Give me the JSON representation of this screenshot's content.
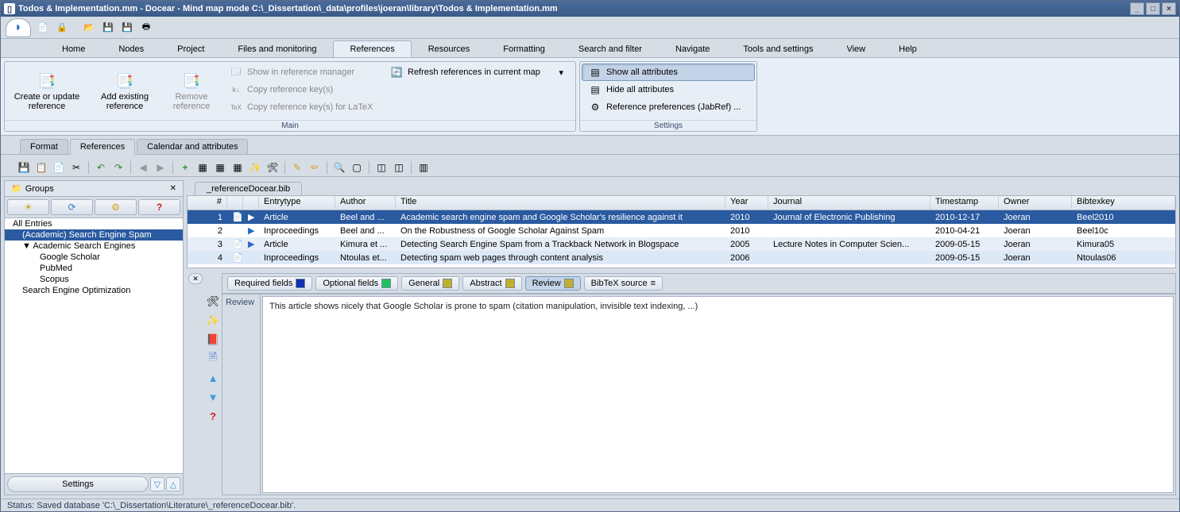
{
  "title": "Todos & Implementation.mm - Docear - Mind map mode C:\\_Dissertation\\_data\\profiles\\joeran\\library\\Todos & Implementation.mm",
  "menus": [
    "Home",
    "Nodes",
    "Project",
    "Files and monitoring",
    "References",
    "Resources",
    "Formatting",
    "Search and filter",
    "Navigate",
    "Tools and settings",
    "View",
    "Help"
  ],
  "active_menu": 4,
  "ribbon": {
    "main_label": "Main",
    "settings_label": "Settings",
    "create": "Create or update reference",
    "add": "Add existing reference",
    "remove": "Remove reference",
    "show_mgr": "Show in reference manager",
    "copy_key": "Copy reference key(s)",
    "copy_latex": "Copy reference key(s) for LaTeX",
    "refresh": "Refresh references in current map",
    "show_attr": "Show all attributes",
    "hide_attr": "Hide all attributes",
    "ref_prefs": "Reference preferences (JabRef) ..."
  },
  "subtabs": [
    "Format",
    "References",
    "Calendar and attributes"
  ],
  "active_subtab": 1,
  "groups_title": "Groups",
  "settings_btn": "Settings",
  "tree": {
    "all": "All Entries",
    "spam": "(Academic) Search Engine Spam",
    "engines": "Academic Search Engines",
    "google": "Google Scholar",
    "pubmed": "PubMed",
    "scopus": "Scopus",
    "seo": "Search Engine Optimization"
  },
  "file_tab": "_referenceDocear.bib",
  "columns": [
    "#",
    "",
    "",
    "Entrytype",
    "Author",
    "Title",
    "Year",
    "Journal",
    "Timestamp",
    "Owner",
    "Bibtexkey"
  ],
  "rows": [
    {
      "n": "1",
      "pdf": "📄",
      "u": "▶",
      "type": "Article",
      "auth": "Beel and ...",
      "title": "Academic search engine spam and Google Scholar's resilience against it",
      "year": "2010",
      "jour": "Journal of Electronic Publishing",
      "ts": "2010-12-17",
      "own": "Joeran",
      "key": "Beel2010"
    },
    {
      "n": "2",
      "pdf": "",
      "u": "▶",
      "type": "Inproceedings",
      "auth": "Beel and ...",
      "title": "On the Robustness of Google Scholar Against Spam",
      "year": "2010",
      "jour": "",
      "ts": "2010-04-21",
      "own": "Joeran",
      "key": "Beel10c"
    },
    {
      "n": "3",
      "pdf": "📄",
      "u": "▶",
      "type": "Article",
      "auth": "Kimura et ...",
      "title": "Detecting Search Engine Spam from a Trackback Network in Blogspace",
      "year": "2005",
      "jour": "Lecture Notes in Computer Scien...",
      "ts": "2009-05-15",
      "own": "Joeran",
      "key": "Kimura05"
    },
    {
      "n": "4",
      "pdf": "📄",
      "u": "",
      "type": "Inproceedings",
      "auth": "Ntoulas et...",
      "title": "Detecting spam web pages through content analysis",
      "year": "2006",
      "jour": "",
      "ts": "2009-05-15",
      "own": "Joeran",
      "key": "Ntoulas06"
    }
  ],
  "detail_tabs": {
    "required": "Required fields",
    "optional": "Optional fields",
    "general": "General",
    "abstract": "Abstract",
    "review": "Review",
    "bibtex": "BibTeX source"
  },
  "colors": {
    "required": "#1030b0",
    "optional": "#20c060",
    "general": "#c0b030",
    "abstract": "#c0b030",
    "review": "#c0b030"
  },
  "review_label": "Review",
  "review_text": "This article shows nicely that Google Scholar is prone to spam (citation manipulation, invisible text indexing, ...)",
  "status": "Status: Saved database 'C:\\_Dissertation\\Literature\\_referenceDocear.bib'."
}
